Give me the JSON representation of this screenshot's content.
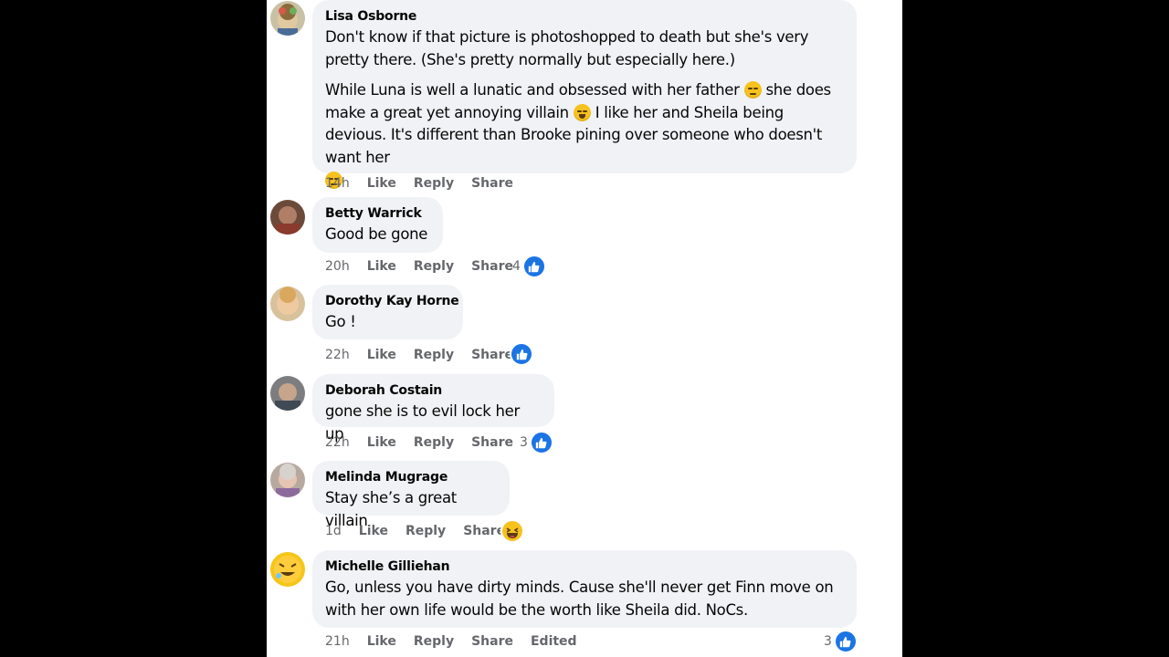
{
  "comments": [
    {
      "name": "Lisa Osborne",
      "paragraphs": [
        "Don't know if that picture is photoshopped to death but she's very pretty there. (She's pretty normally but especially here.)",
        "While Luna is well a lunatic and obsessed with her father",
        "she does make a great yet annoying villain",
        "I like her and Sheila being devious. It's different than Brooke pining over someone who doesn't want her"
      ],
      "time": "14h",
      "like": "Like",
      "reply": "Reply",
      "share": "Share",
      "emojis": [
        "rolling-eyes-emoji",
        "laughing-emoji",
        "rolling-eyes-emoji"
      ]
    },
    {
      "name": "Betty Warrick",
      "text": "Good be gone",
      "time": "20h",
      "like": "Like",
      "reply": "Reply",
      "share": "Share",
      "reaction_count": "4",
      "reaction": "like"
    },
    {
      "name": "Dorothy Kay Horne",
      "text": "Go !",
      "time": "22h",
      "like": "Like",
      "reply": "Reply",
      "share": "Share",
      "reaction": "like"
    },
    {
      "name": "Deborah Costain",
      "text": "gone she is to evil lock her up",
      "time": "22h",
      "like": "Like",
      "reply": "Reply",
      "share": "Share",
      "reaction_count": "3",
      "reaction": "like"
    },
    {
      "name": "Melinda Mugrage",
      "text": "Stay she’s a great villain",
      "time": "1d",
      "like": "Like",
      "reply": "Reply",
      "share": "Share",
      "reaction": "haha"
    },
    {
      "name": "Michelle Gilliehan",
      "text": "Go, unless you have dirty minds. Cause she'll never get Finn move on with her own life would be the worth like Sheila did. NoCs.",
      "time": "21h",
      "like": "Like",
      "reply": "Reply",
      "share": "Share",
      "edited": "Edited",
      "reaction_count": "3",
      "reaction": "like"
    }
  ],
  "colors": {
    "page_background": "#000000",
    "panel": "#ffffff",
    "bubble": "#f0f2f5",
    "text": "#050505",
    "meta": "#65676b",
    "like_blue": "#1b74e4",
    "emoji_yellow": "#f7c21e"
  }
}
